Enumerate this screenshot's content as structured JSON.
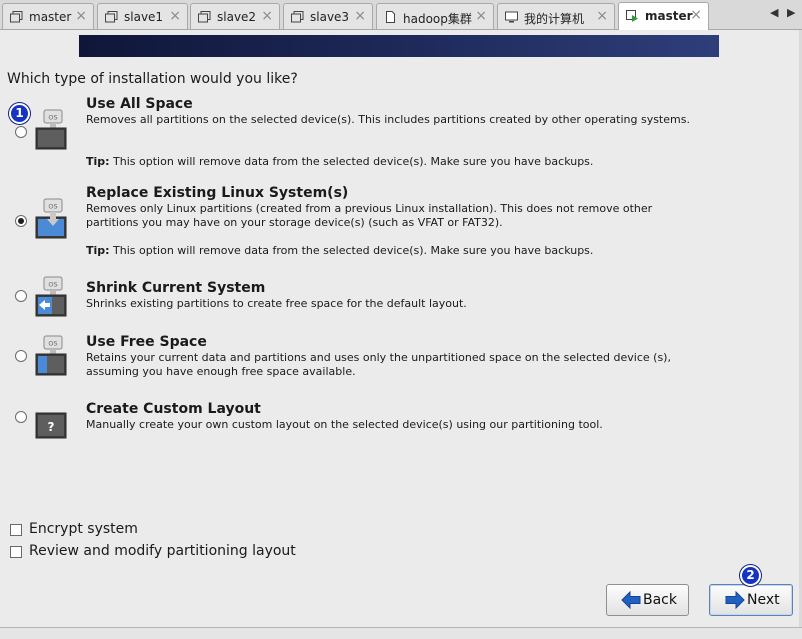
{
  "tabs": [
    {
      "label": "master",
      "icon": "vm-icon"
    },
    {
      "label": "slave1",
      "icon": "vm-icon"
    },
    {
      "label": "slave2",
      "icon": "vm-icon"
    },
    {
      "label": "slave3",
      "icon": "vm-icon"
    },
    {
      "label": "hadoop集群",
      "icon": "document-icon"
    },
    {
      "label": "我的计算机",
      "icon": "computer-icon"
    },
    {
      "label": "master",
      "icon": "vm-running-icon",
      "active": true
    }
  ],
  "tab_close": "×",
  "tab_nav": {
    "prev": "◀",
    "next": "▶"
  },
  "installer": {
    "question": "Which type of installation would you like?",
    "options": [
      {
        "title": "Use All Space",
        "description": "Removes all partitions on the selected device(s).  This includes partitions created by other operating systems.",
        "tip_label": "Tip:",
        "tip": " This option will remove data from the selected device(s).  Make sure you have backups.",
        "selected": false,
        "icon": "disk-os-icon"
      },
      {
        "title": "Replace Existing Linux System(s)",
        "description": "Removes only Linux partitions (created from a previous Linux installation).  This does not remove other partitions you may have on your storage device(s) (such as VFAT or FAT32).",
        "tip_label": "Tip:",
        "tip": " This option will remove data from the selected device(s).  Make sure you have backups.",
        "selected": true,
        "icon": "disk-replace-icon"
      },
      {
        "title": "Shrink Current System",
        "description": "Shrinks existing partitions to create free space for the default layout.",
        "selected": false,
        "icon": "disk-shrink-icon"
      },
      {
        "title": "Use Free Space",
        "description": "Retains your current data and partitions and uses only the unpartitioned space on the selected device (s), assuming you have enough free space available.",
        "selected": false,
        "icon": "disk-free-space-icon"
      },
      {
        "title": "Create Custom Layout",
        "description": "Manually create your own custom layout on the selected device(s) using our partitioning tool.",
        "selected": false,
        "icon": "disk-custom-icon"
      }
    ],
    "icon_os_text": "OS",
    "icon_custom_text": "?",
    "checkboxes": [
      {
        "label": "Encrypt system",
        "checked": false
      },
      {
        "label": "Review and modify partitioning layout",
        "checked": false
      }
    ],
    "buttons": {
      "back": "Back",
      "next": "Next"
    },
    "annotations": {
      "first": "1",
      "second": "2"
    }
  },
  "colors": {
    "banner": "#1c2756",
    "annotation_badge": "#1533c4",
    "arrow_icon": "#1f62c4"
  }
}
